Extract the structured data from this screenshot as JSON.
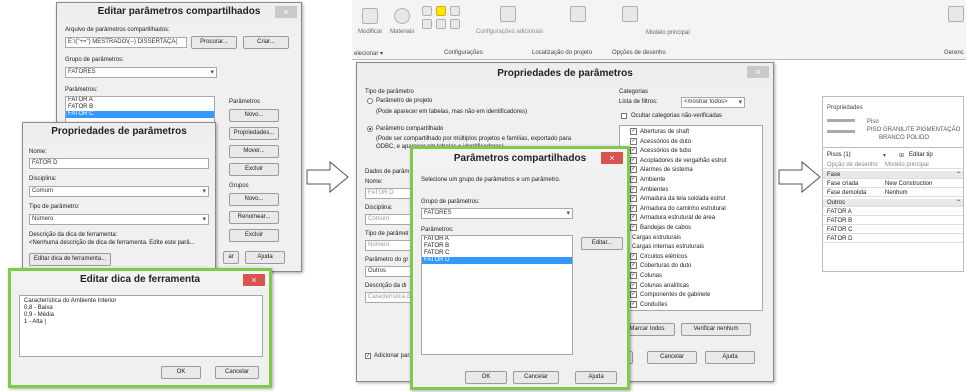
{
  "p1": {
    "main": {
      "title": "Editar parâmetros compartilhados",
      "close": "×",
      "file_label": "Arquivo de parâmetros compartilhados:",
      "file_value": "E:\\(\"+=\") MESTRADO\\(--) DISSERTAÇÃ(",
      "browse": "Procurar...",
      "create": "Criar...",
      "group_label": "Grupo de parâmetros:",
      "group_value": "FATORES",
      "params_label": "Parâmetros:",
      "params": [
        "FATOR A",
        "FATOR B",
        "FATOR C"
      ],
      "selected_param": 2,
      "params_side_label": "Parâmetros",
      "new": "Novo...",
      "properties": "Propriedades...",
      "move": "Mover...",
      "delete": "Excluir",
      "groups_label": "Grupos",
      "group_new": "Novo...",
      "rename": "Renomear...",
      "group_delete": "Excluir",
      "help": "Ajuda",
      "ok_partial": "ar"
    },
    "props": {
      "title": "Propriedades de parâmetros",
      "name_label": "Nome:",
      "name_value": "FATOR D",
      "discipline_label": "Disciplina:",
      "discipline_value": "Comum",
      "type_label": "Tipo de parâmetro:",
      "type_value": "Número",
      "tooltip_label": "Descrição da dica de ferramenta:",
      "tooltip_value": "<Nenhuma descrição de dica de ferramenta. Edite este parâ...",
      "edit_tooltip": "Editar dica de ferramenta..."
    },
    "tooltip": {
      "title": "Editar dica de ferramenta",
      "close": "×",
      "lines": [
        "Característica do Ambiente Interior",
        "0,8 - Baixa",
        "0,9 - Média",
        "1 - Alta |"
      ],
      "ok": "OK",
      "cancel": "Cancelar"
    }
  },
  "p2": {
    "ribbon": {
      "modify": "Modificar",
      "materials": "Materiais",
      "settings": "Configurações adicionais",
      "project_location": "Localização do projeto",
      "drawing_options": "Opções de desenho",
      "model_main": "Modelo principal",
      "select": "elecionar ▾",
      "configurations": "Configurações",
      "location": "Localização do projeto",
      "drawing_options2": "Opções de desenho",
      "manage": "Gerenc"
    },
    "props": {
      "title": "Propriedades de parâmetros",
      "close": "×",
      "param_type_label": "Tipo de parâmetro",
      "project_param": "Parâmetro de projeto",
      "project_param_desc": "(Pode aparecer em tabelas, mas não em identificadores)",
      "shared_param": "Parâmetro compartilhado",
      "shared_param_desc1": "(Pode ser compartilhado por múltiplos projetos e famílias, exportado para",
      "shared_param_desc2": "ODBC, e aparecer em tabelas e identificadores)",
      "param_data": "Dados de parâm",
      "name_label": "Nome:",
      "name_value": "FATOR D",
      "discipline_label": "Disciplina:",
      "discipline_value": "Comum",
      "type_label": "Tipo de parâmet",
      "type_value": "Número",
      "group_by": "Parâmetro do gr",
      "group_by_value": "Outros",
      "desc_label": "Descrição da di",
      "desc_value": "Característica d",
      "add_to": "Adicionar para",
      "categories_label": "Categorias",
      "filter_label": "Lista de filtros:",
      "filter_value": "<mostrar todos>",
      "hide_unchecked": "Ocultar categorias não-verificadas",
      "categories": [
        "Aberturas de shaft",
        "Acessórios de duto",
        "Acessórios de tubo",
        "Acopladores de vergalhão estrut",
        "Alarmes de sistema",
        "Ambiente",
        "Ambientes",
        "Armadura da tela soldada estrut",
        "Armadura do caminho estrutural",
        "Armadura estrutural de área",
        "Bandejas de cabos",
        "Cargas estruturais",
        "Cargas internas estruturais",
        "Circuitos elétricos",
        "Coberturas do duto",
        "Colunas",
        "Colunas analíticas",
        "Componentes de gabinete",
        "Conduítes"
      ],
      "check_all": "Marcar todos",
      "check_none": "Verificar nenhum",
      "ok_partial": "K",
      "cancel": "Cancelar",
      "help": "Ajuda"
    },
    "shared": {
      "title": "Parâmetros compartilhados",
      "close": "×",
      "select_label": "Selecione um grupo de parâmetros e um parâmetro.",
      "group_label": "Grupo de parâmetros:",
      "group_value": "FATORES",
      "params_label": "Parâmetros:",
      "params": [
        "FATOR A",
        "FATOR B",
        "FATOR C",
        "FATOR D"
      ],
      "selected_param": 3,
      "edit": "Editar...",
      "ok": "OK",
      "cancel": "Cancelar",
      "help": "Ajuda"
    }
  },
  "p3": {
    "title": "Propriedades",
    "type_line1": "Piso",
    "type_line2": "PISO GRANILITE PIGMENTAÇÃO",
    "type_line3": "BRANCO POLIDO",
    "selector": "Pisos (1)",
    "edit_type": "Editar tip",
    "drawing_option": "Opção de desenho",
    "drawing_value": "Modelo principal",
    "phase_header": "Fase",
    "phase_created": "Fase criada",
    "phase_created_value": "New Construction",
    "phase_demolished": "Fase demolida",
    "phase_demolished_value": "Nenhum",
    "others_header": "Outros",
    "fatores": [
      "FATOR A",
      "FATOR B",
      "FATOR C",
      "FATOR D"
    ]
  },
  "colors": {
    "accent": "#3399ff",
    "green_frame": "#7ecb4a",
    "close_red": "#d9534f",
    "highlight_yellow": "#ffe600"
  }
}
